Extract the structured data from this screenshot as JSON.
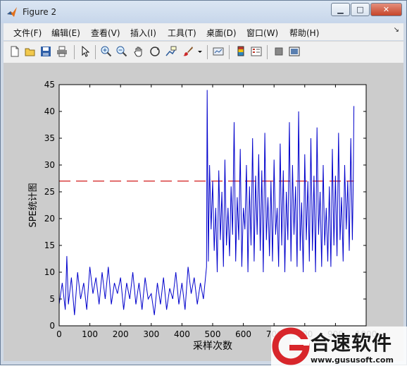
{
  "window": {
    "title": "Figure 2",
    "min_glyph": "▁",
    "max_glyph": "□",
    "close_glyph": "✕"
  },
  "menu": {
    "items": [
      "文件(F)",
      "编辑(E)",
      "查看(V)",
      "插入(I)",
      "工具(T)",
      "桌面(D)",
      "窗口(W)",
      "帮助(H)"
    ],
    "overflow_glyph": "↘"
  },
  "toolbar": {
    "icons": [
      "new-figure-icon",
      "open-file-icon",
      "save-icon",
      "print-icon",
      "pointer-icon",
      "zoom-in-icon",
      "zoom-out-icon",
      "pan-hand-icon",
      "rotate-3d-icon",
      "data-cursor-icon",
      "brush-icon",
      "brush-dropdown-icon",
      "link-plot-icon",
      "colorbar-icon",
      "legend-icon",
      "hide-plot-tools-icon",
      "show-plot-tools-icon"
    ]
  },
  "watermark": {
    "text": "合速软件",
    "url": "www.gususoft.com",
    "accent": "#d8262b"
  },
  "chart_data": {
    "type": "line",
    "xlabel": "采样次数",
    "ylabel": "SPE统计图",
    "xlim": [
      0,
      1000
    ],
    "ylim": [
      0,
      45
    ],
    "xticks": [
      0,
      100,
      200,
      300,
      400,
      500,
      600,
      700,
      800,
      900,
      1000
    ],
    "yticks": [
      0,
      5,
      10,
      15,
      20,
      25,
      30,
      35,
      40,
      45
    ],
    "grid": false,
    "control_limit": {
      "y": 27,
      "color": "#cc0000",
      "style": "dashed",
      "x_range": [
        0,
        960
      ]
    },
    "series": [
      {
        "color": "#0000cc",
        "x": [
          0,
          10,
          20,
          25,
          30,
          40,
          50,
          60,
          70,
          80,
          90,
          100,
          110,
          120,
          130,
          140,
          150,
          160,
          170,
          180,
          190,
          200,
          210,
          220,
          230,
          240,
          250,
          260,
          270,
          280,
          290,
          300,
          310,
          320,
          330,
          340,
          350,
          360,
          370,
          380,
          390,
          400,
          410,
          420,
          430,
          440,
          450,
          460,
          470,
          480,
          482,
          486,
          490,
          495,
          500,
          505,
          510,
          515,
          520,
          525,
          530,
          535,
          540,
          545,
          550,
          555,
          560,
          565,
          570,
          575,
          580,
          585,
          590,
          595,
          600,
          605,
          610,
          615,
          620,
          625,
          630,
          635,
          640,
          645,
          650,
          655,
          660,
          665,
          670,
          675,
          680,
          685,
          690,
          695,
          700,
          705,
          710,
          715,
          720,
          725,
          730,
          735,
          740,
          745,
          750,
          755,
          760,
          765,
          770,
          775,
          780,
          785,
          790,
          795,
          800,
          805,
          810,
          815,
          820,
          825,
          830,
          835,
          840,
          845,
          850,
          855,
          860,
          865,
          870,
          875,
          880,
          885,
          890,
          895,
          900,
          905,
          910,
          915,
          920,
          925,
          930,
          935,
          940,
          945,
          950,
          955,
          958,
          960
        ],
        "y": [
          4,
          8,
          3,
          13,
          4,
          9,
          2,
          10,
          5,
          8,
          3,
          11,
          6,
          9,
          4,
          10,
          5,
          11,
          4,
          8,
          6,
          9,
          3,
          8,
          5,
          10,
          4,
          8,
          3,
          9,
          5,
          6,
          2,
          8,
          4,
          9,
          3,
          7,
          5,
          10,
          4,
          8,
          3,
          11,
          6,
          9,
          4,
          8,
          5,
          11,
          44,
          12,
          30,
          18,
          27,
          14,
          22,
          10,
          29,
          16,
          25,
          11,
          31,
          15,
          22,
          13,
          26,
          17,
          38,
          12,
          24,
          16,
          33,
          11,
          22,
          18,
          30,
          10,
          26,
          15,
          35,
          12,
          28,
          17,
          32,
          14,
          29,
          10,
          36,
          16,
          24,
          13,
          27,
          12,
          31,
          17,
          22,
          11,
          34,
          15,
          29,
          10,
          25,
          16,
          38,
          12,
          30,
          17,
          26,
          11,
          40,
          14,
          23,
          10,
          32,
          16,
          27,
          12,
          35,
          14,
          28,
          10,
          37,
          17,
          25,
          11,
          30,
          15,
          22,
          12,
          26,
          11,
          33,
          15,
          28,
          13,
          36,
          16,
          24,
          12,
          30,
          18,
          27,
          14,
          35,
          16,
          27,
          41
        ]
      }
    ]
  }
}
